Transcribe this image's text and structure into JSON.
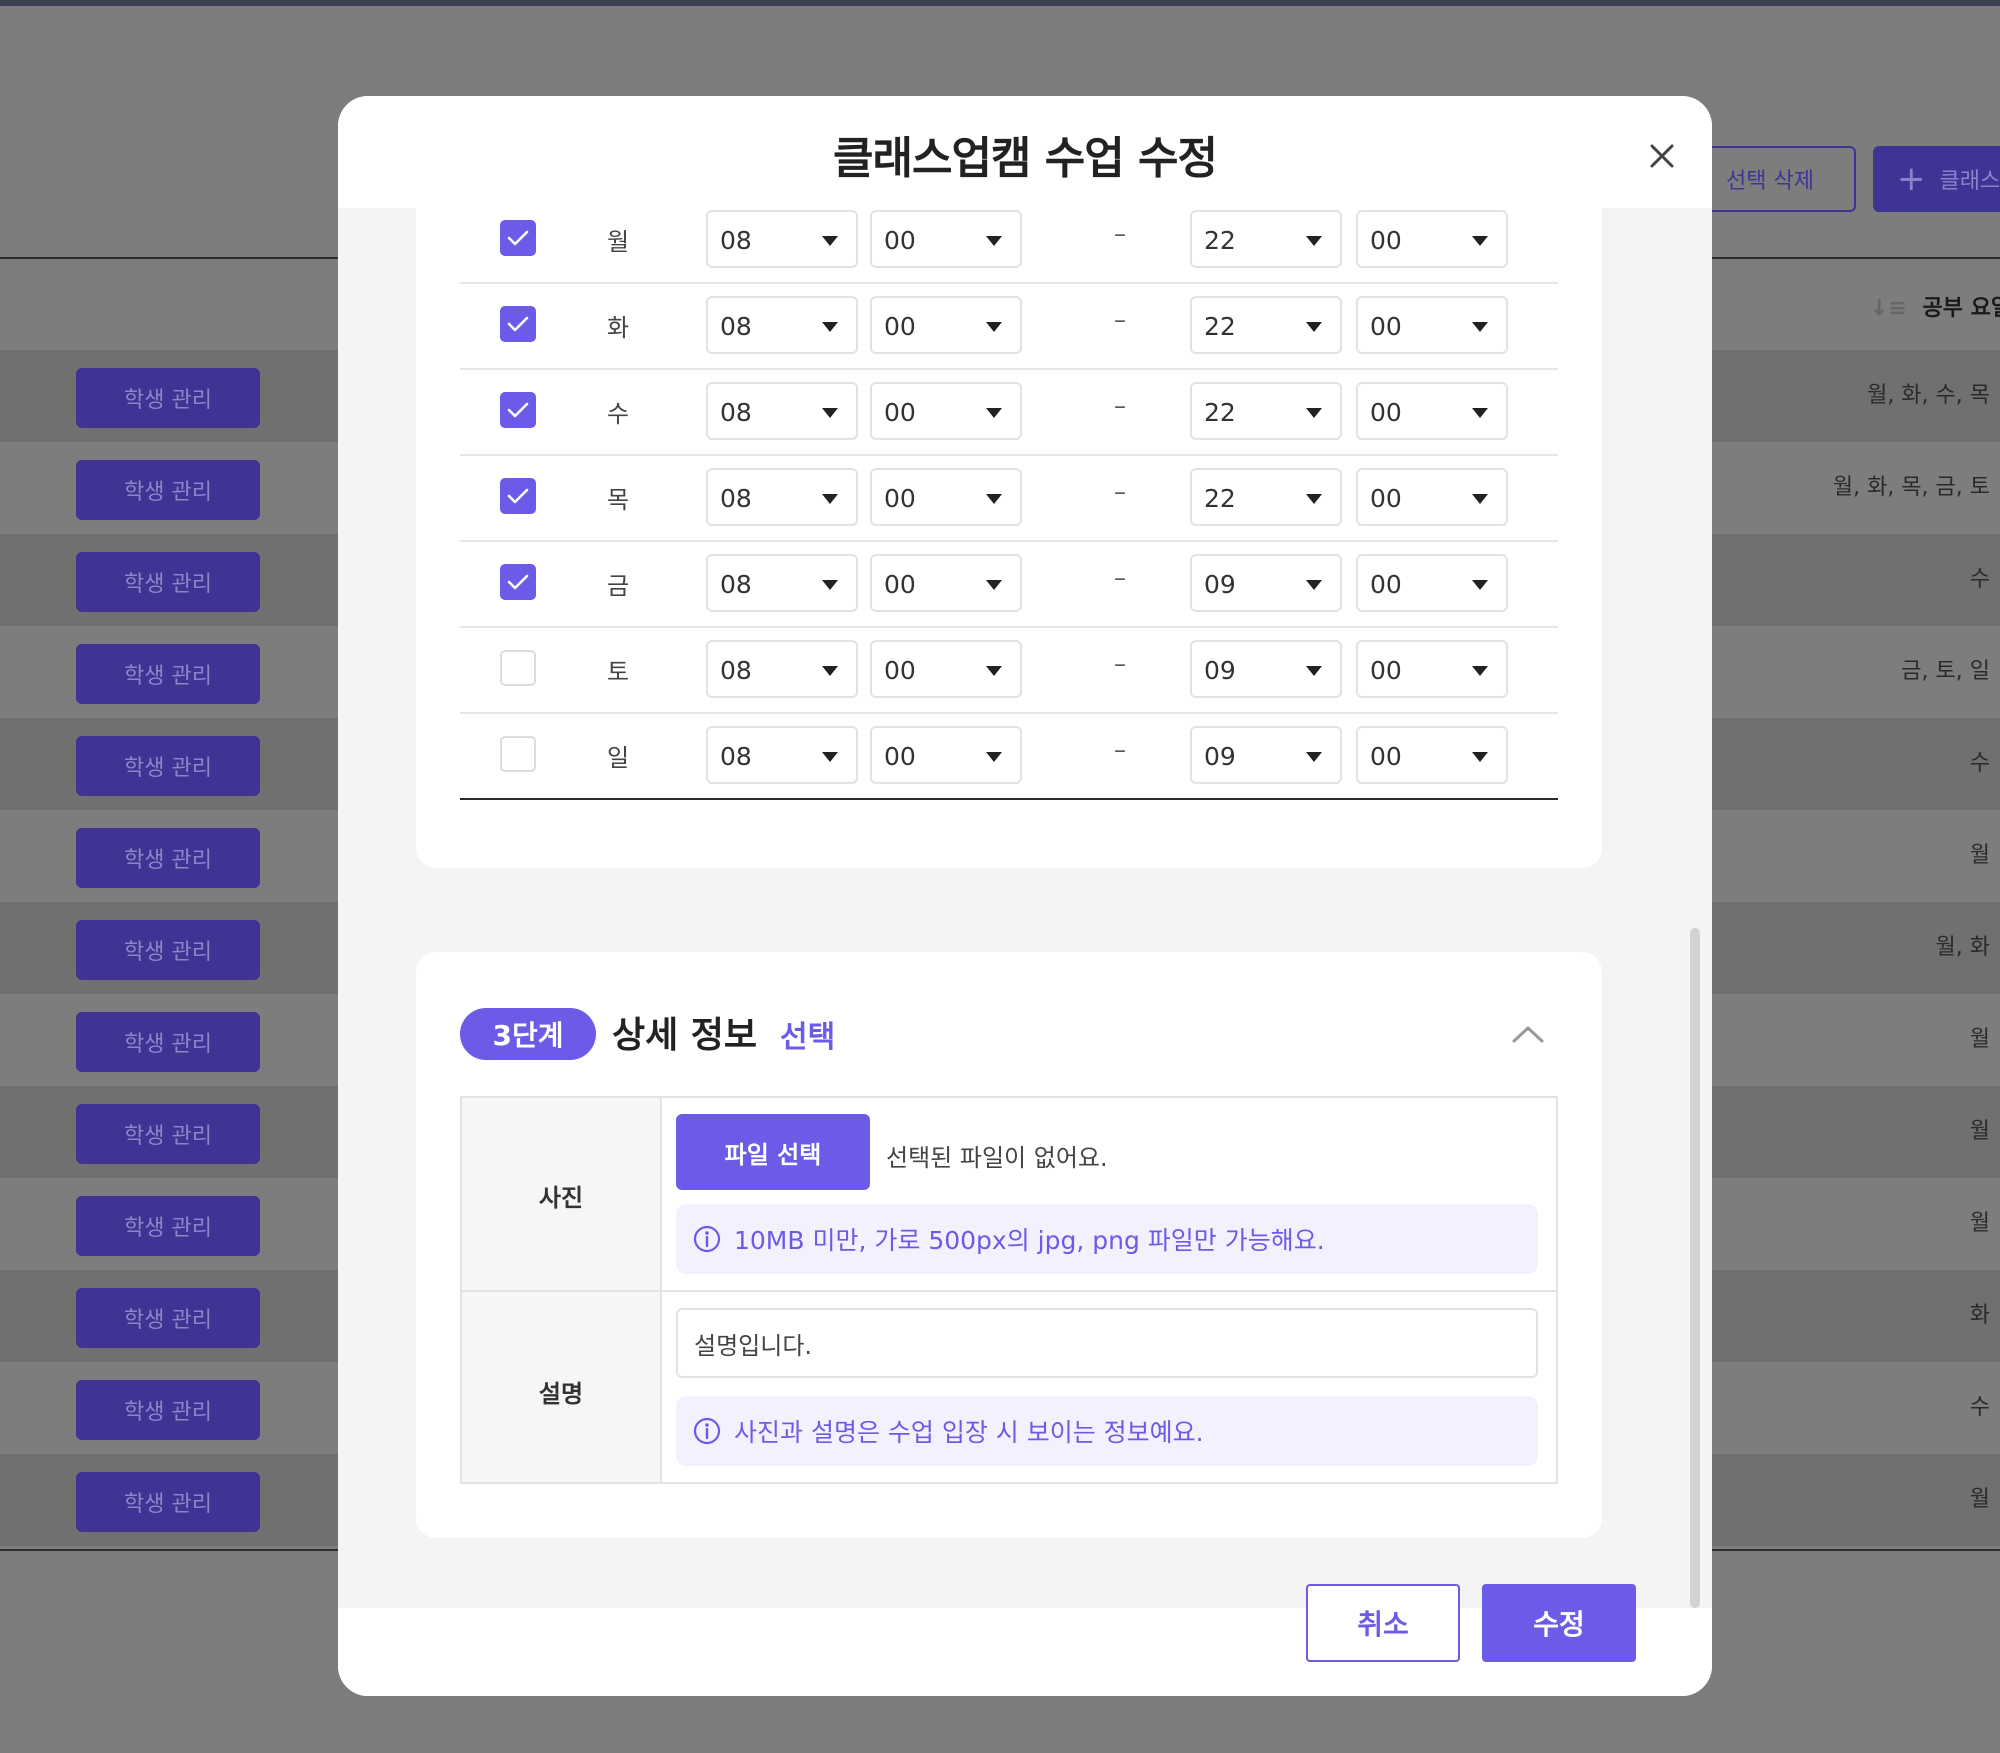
{
  "background": {
    "top_buttons": {
      "delete_label": "선택 삭제",
      "add_label": "클래스"
    },
    "sort_header": "공부 요일",
    "manage_label": "학생 관리",
    "rows": [
      {
        "days": "월, 화, 수, 목"
      },
      {
        "days": "월, 화, 목, 금, 토"
      },
      {
        "days": "수"
      },
      {
        "days": "금, 토, 일"
      },
      {
        "days": "수"
      },
      {
        "days": "월"
      },
      {
        "days": "월, 화"
      },
      {
        "days": "월"
      },
      {
        "days": "월"
      },
      {
        "days": "월"
      },
      {
        "days": "화"
      },
      {
        "days": "수"
      },
      {
        "days": "월"
      }
    ]
  },
  "modal": {
    "title": "클래스업캠 수업 수정",
    "schedule": [
      {
        "day": "월",
        "checked": true,
        "start_hour": "08",
        "start_min": "00",
        "end_hour": "22",
        "end_min": "00"
      },
      {
        "day": "화",
        "checked": true,
        "start_hour": "08",
        "start_min": "00",
        "end_hour": "22",
        "end_min": "00"
      },
      {
        "day": "수",
        "checked": true,
        "start_hour": "08",
        "start_min": "00",
        "end_hour": "22",
        "end_min": "00"
      },
      {
        "day": "목",
        "checked": true,
        "start_hour": "08",
        "start_min": "00",
        "end_hour": "22",
        "end_min": "00"
      },
      {
        "day": "금",
        "checked": true,
        "start_hour": "08",
        "start_min": "00",
        "end_hour": "09",
        "end_min": "00"
      },
      {
        "day": "토",
        "checked": false,
        "start_hour": "08",
        "start_min": "00",
        "end_hour": "09",
        "end_min": "00"
      },
      {
        "day": "일",
        "checked": false,
        "start_hour": "08",
        "start_min": "00",
        "end_hour": "09",
        "end_min": "00"
      }
    ],
    "schedule_separator": "–",
    "step3": {
      "badge": "3단계",
      "title": "상세 정보",
      "optional": "선택",
      "photo_label": "사진",
      "file_button": "파일 선택",
      "file_status": "선택된 파일이 없어요.",
      "photo_info": "10MB 미만, 가로 500px의 jpg, png 파일만 가능해요.",
      "desc_label": "설명",
      "desc_value": "설명입니다.",
      "desc_info": "사진과 설명은 수업 입장 시 보이는 정보예요."
    },
    "footer": {
      "cancel": "취소",
      "save": "수정"
    }
  },
  "colors": {
    "accent": "#6c5be6",
    "accent_dark": "#3f3494",
    "overlay": "#7d7d7d"
  }
}
